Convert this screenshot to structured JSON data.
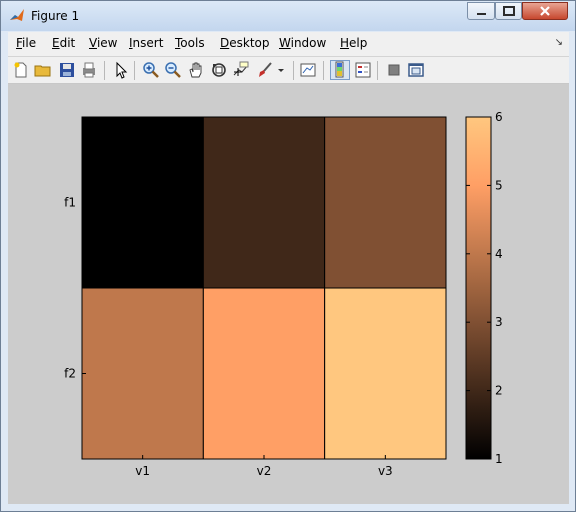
{
  "window": {
    "title": "Figure 1"
  },
  "menu": [
    {
      "label": "File",
      "accel": "F",
      "rest": "ile"
    },
    {
      "label": "Edit",
      "accel": "E",
      "rest": "dit"
    },
    {
      "label": "View",
      "accel": "V",
      "rest": "iew"
    },
    {
      "label": "Insert",
      "accel": "I",
      "rest": "nsert"
    },
    {
      "label": "Tools",
      "accel": "T",
      "rest": "ools"
    },
    {
      "label": "Desktop",
      "accel": "D",
      "rest": "esktop"
    },
    {
      "label": "Window",
      "accel": "W",
      "rest": "indow"
    },
    {
      "label": "Help",
      "accel": "H",
      "rest": "elp"
    }
  ],
  "toolbar_icons": [
    "new-figure-icon",
    "open-file-icon",
    "save-icon",
    "print-icon",
    "select-arrow-icon",
    "zoom-in-icon",
    "zoom-out-icon",
    "pan-hand-icon",
    "rotate-3d-icon",
    "data-cursor-icon",
    "brush-icon",
    "brush-dropdown-icon",
    "link-plot-icon",
    "colorbar-icon",
    "legend-icon",
    "hide-plot-tools-icon",
    "show-plot-tools-icon"
  ],
  "chart_data": {
    "type": "heatmap",
    "x_categories": [
      "v1",
      "v2",
      "v3"
    ],
    "y_categories": [
      "f1",
      "f2"
    ],
    "values": [
      [
        1,
        2,
        3
      ],
      [
        4,
        5,
        6
      ]
    ],
    "colormap": "copper",
    "colorbar": {
      "ticks": [
        1,
        2,
        3,
        4,
        5,
        6
      ],
      "range": [
        1,
        6
      ]
    },
    "title": "",
    "xlabel": "",
    "ylabel": ""
  }
}
